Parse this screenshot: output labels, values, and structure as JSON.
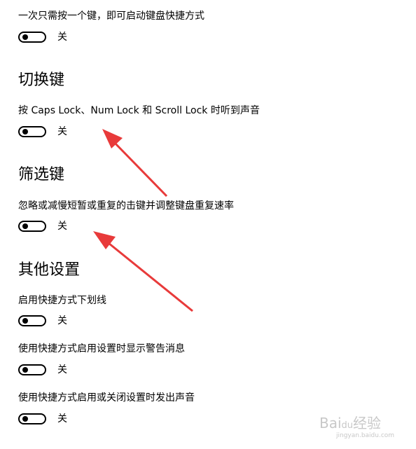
{
  "sections": [
    {
      "heading": null,
      "rows": [
        {
          "label": "一次只需按一个键，即可启动键盘快捷方式",
          "state": "关"
        }
      ]
    },
    {
      "heading": "切换键",
      "rows": [
        {
          "label": "按 Caps Lock、Num Lock 和 Scroll Lock 时听到声音",
          "state": "关"
        }
      ]
    },
    {
      "heading": "筛选键",
      "rows": [
        {
          "label": "忽略或减慢短暂或重复的击键并调整键盘重复速率",
          "state": "关"
        }
      ]
    },
    {
      "heading": "其他设置",
      "rows": [
        {
          "label": "启用快捷方式下划线",
          "state": "关"
        },
        {
          "label": "使用快捷方式启用设置时显示警告消息",
          "state": "关"
        },
        {
          "label": "使用快捷方式启用或关闭设置时发出声音",
          "state": "关"
        }
      ]
    }
  ],
  "annotation_color": "#e83a3a",
  "watermark": {
    "text": "Bai",
    "paw": "du",
    "suffix": "经验",
    "url": "jingyan.baidu.com"
  }
}
